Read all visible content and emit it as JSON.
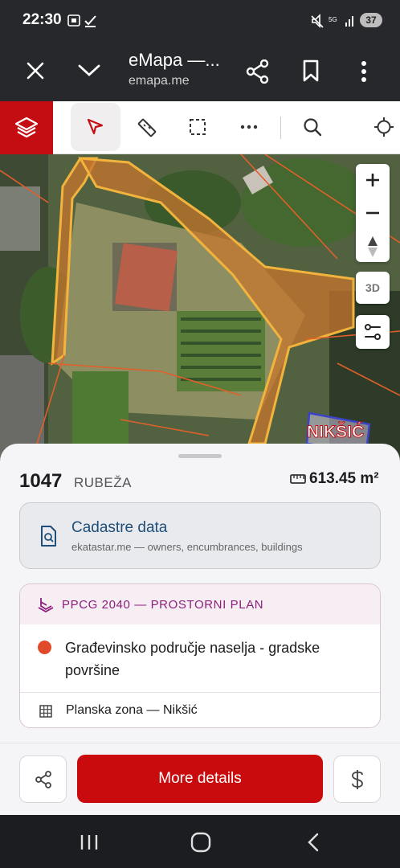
{
  "status_bar": {
    "time": "22:30",
    "battery": "37",
    "network": "5G"
  },
  "browser": {
    "title": "eMapa —...",
    "url": "emapa.me"
  },
  "map": {
    "place_label": "NIKŠIĆ",
    "mode_3d": "3D"
  },
  "parcel": {
    "number": "1047",
    "municipality": "RUBEŽA",
    "area": "613.45 m²"
  },
  "cadastre": {
    "title": "Cadastre data",
    "subtitle": "ekatastar.me — owners, encumbrances, buildings"
  },
  "plan": {
    "header": "PPCG 2040 — PROSTORNI PLAN",
    "zone_label": "Građevinsko područje naselja - gradske površine",
    "zone_color": "#e04a2b",
    "planning_zone": "Planska zona — Nikšić"
  },
  "actions": {
    "more_details": "More details"
  },
  "colors": {
    "brand_red": "#c40d12",
    "plan_purple": "#8a1f7c"
  }
}
